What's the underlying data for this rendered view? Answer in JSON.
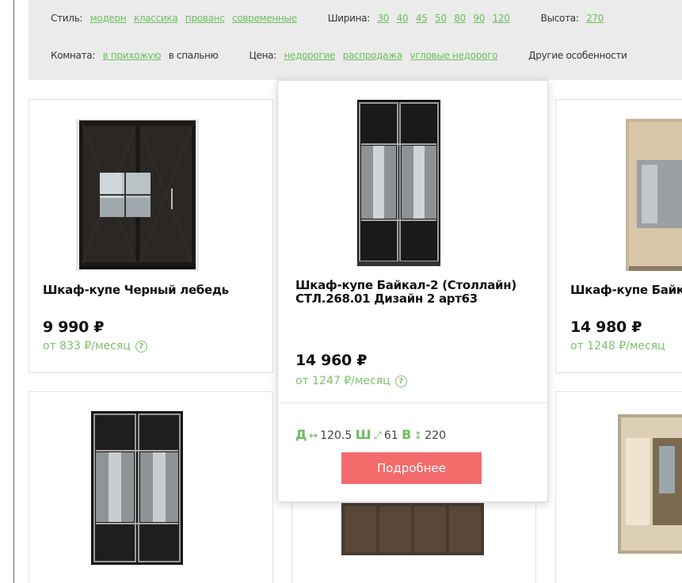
{
  "filters": {
    "style_label": "Стиль:",
    "styles": [
      "модерн",
      "классика",
      "прованс",
      "современные"
    ],
    "width_label": "Ширина:",
    "widths": [
      "30",
      "40",
      "45",
      "50",
      "80",
      "90",
      "120"
    ],
    "height_label": "Высота:",
    "heights": [
      "270"
    ],
    "room_label": "Комната:",
    "rooms": [
      "в прихожую"
    ],
    "room_plain": "в спальню",
    "price_label": "Цена:",
    "prices": [
      "недорогие",
      "распродажа",
      "угловые недорого"
    ],
    "other_label": "Другие особенности"
  },
  "products": [
    {
      "title": "Шкаф-купе Черный лебедь",
      "price": "9 990 ₽",
      "credit": "от 833 ₽/месяц"
    },
    {
      "title": "Шкаф-купе Байкал-2 (Столлайн) СТЛ.268.01 Дизайн 2 арт63",
      "price": "14 960 ₽",
      "credit": "от 1247 ₽/месяц",
      "dims": {
        "d_label": "Д",
        "d_value": "120.5",
        "w_label": "Ш",
        "w_value": "61",
        "h_label": "В",
        "h_value": "220"
      },
      "button": "Подробнее"
    },
    {
      "title": "Шкаф-купе Байк",
      "price": "14 980 ₽",
      "credit": "от 1248 ₽/месяц"
    }
  ],
  "help_glyph": "?",
  "icons": {
    "depth_arrow": "↔",
    "width_arrow": "⤢",
    "height_arrow": "↕"
  }
}
